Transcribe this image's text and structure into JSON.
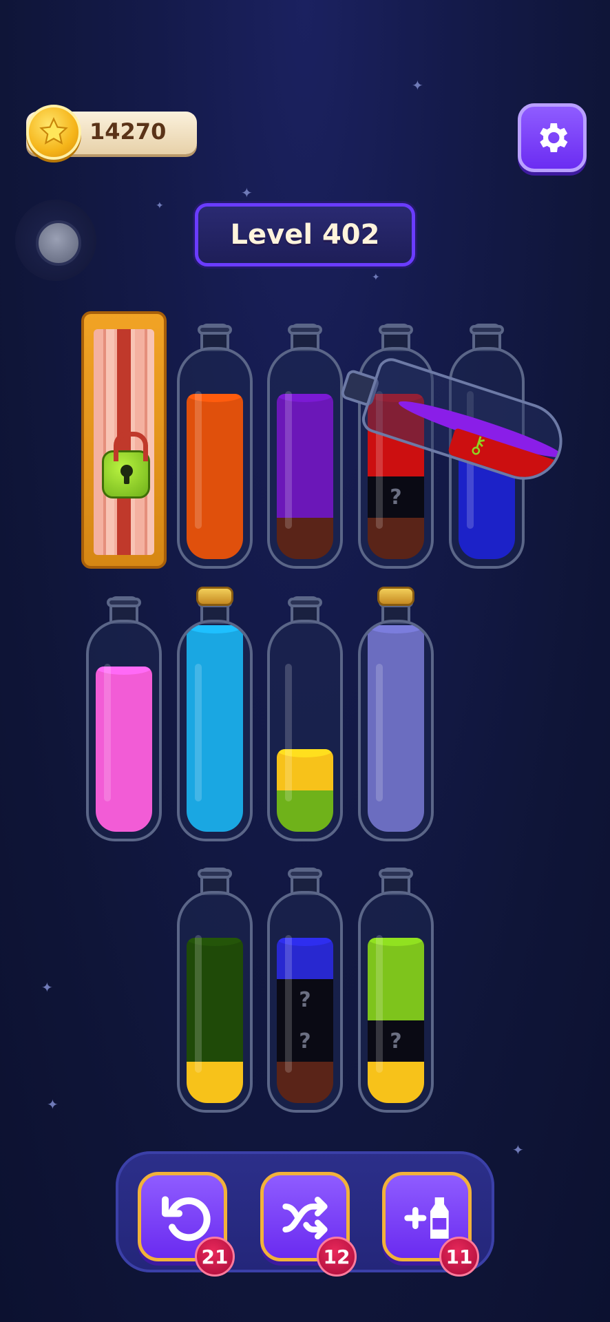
{
  "hud": {
    "coins": "14270",
    "level": "Level 402",
    "coin_icon": "star-coin-icon",
    "settings_icon": "gear-icon"
  },
  "tools": [
    {
      "name": "undo",
      "icon": "undo-icon",
      "count": "21"
    },
    {
      "name": "shuffle",
      "icon": "shuffle-icon",
      "count": "12"
    },
    {
      "name": "add-bottle",
      "icon": "add-bottle-icon",
      "count": "11"
    }
  ],
  "colors": {
    "orange": "#e0500c",
    "purple": "#6b17b8",
    "brown": "#5a2418",
    "red": "#cc0f10",
    "hidden": "#0a0a14",
    "blue": "#1c22c8",
    "pink": "#f25cd6",
    "cyan": "#1aa7e2",
    "lavender": "#6b6dc0",
    "yellow": "#f7c21a",
    "lime": "#6fb21a",
    "darkgreen": "#1f4a08",
    "navy": "#2828d0",
    "lightgreen": "#7ec41c"
  },
  "bottles": [
    {
      "id": 1,
      "locked": true,
      "layers": []
    },
    {
      "id": 2,
      "layers": [
        {
          "c": "orange",
          "h": 4
        }
      ]
    },
    {
      "id": 3,
      "layers": [
        {
          "c": "brown",
          "h": 1
        },
        {
          "c": "purple",
          "h": 3
        }
      ]
    },
    {
      "id": 4,
      "layers": [
        {
          "c": "brown",
          "h": 1
        },
        {
          "c": "hidden",
          "h": 1,
          "q": "?"
        },
        {
          "c": "red",
          "h": 2
        }
      ]
    },
    {
      "id": 5,
      "layers": [
        {
          "c": "blue",
          "h": 3
        }
      ]
    },
    {
      "id": 6,
      "layers": [
        {
          "c": "pink",
          "h": 4
        }
      ]
    },
    {
      "id": 7,
      "corked": true,
      "layers": [
        {
          "c": "cyan",
          "h": 5
        }
      ]
    },
    {
      "id": 8,
      "layers": [
        {
          "c": "lime",
          "h": 1
        },
        {
          "c": "yellow",
          "h": 1
        }
      ]
    },
    {
      "id": 9,
      "corked": true,
      "layers": [
        {
          "c": "lavender",
          "h": 5
        }
      ]
    },
    {
      "id": 10,
      "layers": [
        {
          "c": "yellow",
          "h": 1
        },
        {
          "c": "darkgreen",
          "h": 3
        }
      ]
    },
    {
      "id": 11,
      "layers": [
        {
          "c": "brown",
          "h": 1
        },
        {
          "c": "hidden",
          "h": 1,
          "q": "?"
        },
        {
          "c": "hidden",
          "h": 1,
          "q": "?"
        },
        {
          "c": "navy",
          "h": 1
        }
      ]
    },
    {
      "id": 12,
      "layers": [
        {
          "c": "yellow",
          "h": 1
        },
        {
          "c": "hidden",
          "h": 1,
          "q": "?"
        },
        {
          "c": "lightgreen",
          "h": 2
        }
      ]
    }
  ]
}
